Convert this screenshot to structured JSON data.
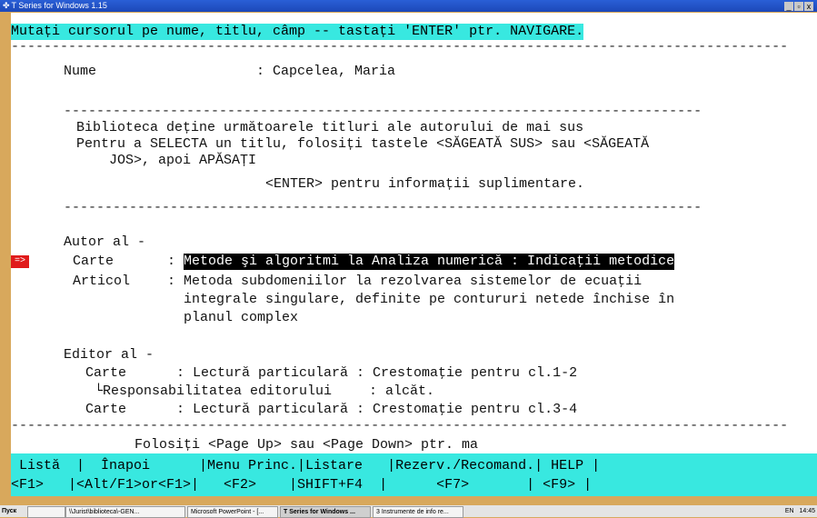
{
  "window": {
    "title": "T Series for Windows 1.15",
    "buttons": [
      "_",
      "▫",
      "x"
    ]
  },
  "screen": {
    "instruction": "Mutați cursorul pe nume, titlu, câmp -- tastați 'ENTER' ptr. NAVIGARE.",
    "name_label": "Nume",
    "name_value": ": Capcelea, Maria",
    "info_line1": "Biblioteca deține următoarele titluri ale autorului de mai sus",
    "info_line2": "Pentru a SELECTA un titlu, folosiți tastele <SĂGEATĂ SUS> sau <SĂGEATĂ",
    "info_line3": "JOS>, apoi APĂSAȚI",
    "info_line4": "<ENTER> pentru informații suplimentare.",
    "author_header": "Autor al -",
    "cursor_marker": "=>",
    "author_items": [
      {
        "type": "Carte",
        "sep": ":",
        "title": "Metode şi algoritmi la Analiza numerică : Indicaţii metodice"
      },
      {
        "type": "Articol",
        "sep": ":",
        "title": "Metoda subdomeniilor la rezolvarea sistemelor de ecuaţii",
        "cont1": "integrale singulare, definite pe contururi netede închise în",
        "cont2": "planul complex"
      }
    ],
    "editor_header": "Editor al -",
    "editor_items": [
      {
        "type": "Carte",
        "title": ": Lectură particulară : Crestomaţie pentru cl.1-2"
      },
      {
        "type": "└Responsabilitatea editorului",
        "title": ": alcăt."
      },
      {
        "type": "Carte",
        "title": ": Lectură particulară : Crestomaţie pentru cl.3-4"
      }
    ],
    "page_hint": "Folosiți <Page Up> sau <Page Down> ptr. ma"
  },
  "function_bar": {
    "line1": " Listă  |  Înapoi      |Menu Princ.|Listare   |Rezerv./Recomand.| HELP |",
    "line2": "<F1>   |<Alt/F1>or<F1>|   <F2>    |SHIFT+F4  |      <F7>       | <F9> |"
  },
  "taskbar": {
    "start_label": "Пуск",
    "items": [
      "\\\\Jurist\\biblioteca\\-GEN...",
      "Microsoft PowerPoint - [...",
      "T Series for Windows ...",
      "3 Instrumente de info re..."
    ],
    "lang": "EN",
    "clock": "14:45"
  }
}
